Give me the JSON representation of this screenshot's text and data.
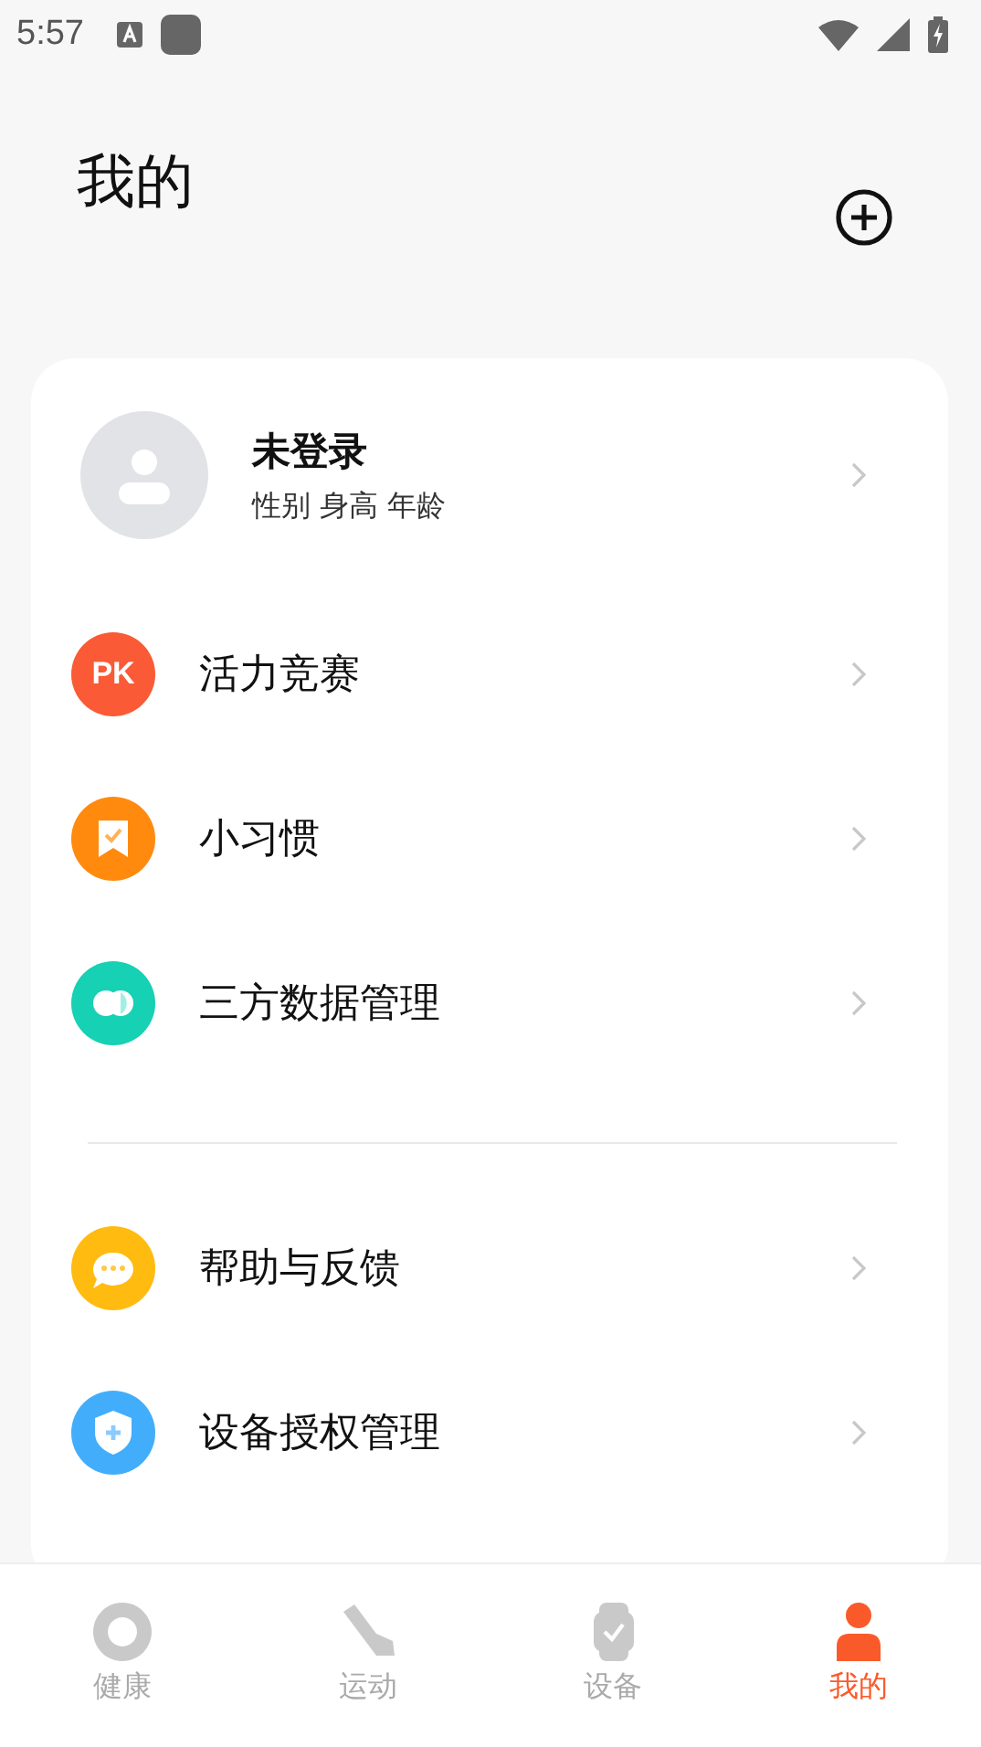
{
  "status_bar": {
    "time": "5:57"
  },
  "header": {
    "title": "我的"
  },
  "profile": {
    "name": "未登录",
    "details": "性别 身高 年龄"
  },
  "menu_groups": [
    {
      "items": [
        {
          "label": "活力竞赛",
          "kind": "pk",
          "icon_text": "PK",
          "color": "#fa5a35"
        },
        {
          "label": "小习惯",
          "kind": "habit",
          "color": "#ff8a0e"
        },
        {
          "label": "三方数据管理",
          "kind": "data",
          "color": "#16d1b4"
        }
      ]
    },
    {
      "items": [
        {
          "label": "帮助与反馈",
          "kind": "help",
          "color": "#ffbb10"
        },
        {
          "label": "设备授权管理",
          "kind": "shield",
          "color": "#42aefb"
        }
      ]
    }
  ],
  "tabs": [
    {
      "label": "健康",
      "kind": "health",
      "selected": false
    },
    {
      "label": "运动",
      "kind": "sport",
      "selected": false
    },
    {
      "label": "设备",
      "kind": "device",
      "selected": false
    },
    {
      "label": "我的",
      "kind": "me",
      "selected": true
    }
  ]
}
